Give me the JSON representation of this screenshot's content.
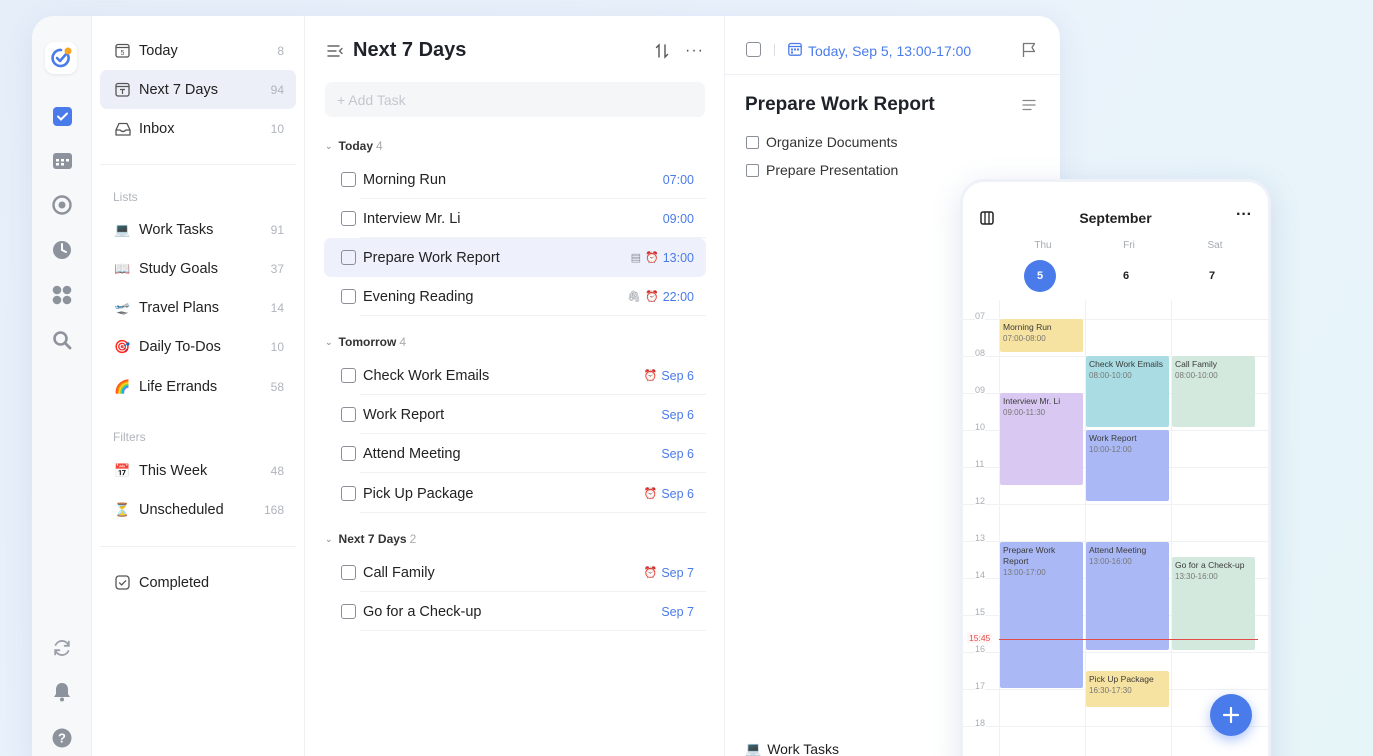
{
  "sidebar": {
    "smart": [
      {
        "label": "Today",
        "count": "8",
        "icon": "calendar-day-icon"
      },
      {
        "label": "Next 7 Days",
        "count": "94",
        "icon": "calendar-week-icon"
      },
      {
        "label": "Inbox",
        "count": "10",
        "icon": "inbox-icon"
      }
    ],
    "lists_label": "Lists",
    "lists": [
      {
        "emoji": "💻",
        "label": "Work Tasks",
        "count": "91"
      },
      {
        "emoji": "📖",
        "label": "Study Goals",
        "count": "37"
      },
      {
        "emoji": "🛫",
        "label": "Travel Plans",
        "count": "14"
      },
      {
        "emoji": "🎯",
        "label": "Daily To-Dos",
        "count": "10"
      },
      {
        "emoji": "🌈",
        "label": "Life Errands",
        "count": "58"
      }
    ],
    "filters_label": "Filters",
    "filters": [
      {
        "emoji": "📅",
        "label": "This Week",
        "count": "48"
      },
      {
        "emoji": "⏳",
        "label": "Unscheduled",
        "count": "168"
      }
    ],
    "completed_label": "Completed"
  },
  "tasklist": {
    "title": "Next 7 Days",
    "add_placeholder": "+ Add Task",
    "groups": [
      {
        "name": "Today",
        "count": "4",
        "tasks": [
          {
            "title": "Morning Run",
            "meta": "07:00"
          },
          {
            "title": "Interview Mr. Li",
            "meta": "09:00"
          },
          {
            "title": "Prepare Work Report",
            "meta": "13:00"
          },
          {
            "title": "Evening Reading",
            "meta": "22:00"
          }
        ]
      },
      {
        "name": "Tomorrow",
        "count": "4",
        "tasks": [
          {
            "title": "Check Work Emails",
            "meta": "Sep 6"
          },
          {
            "title": "Work Report",
            "meta": "Sep 6"
          },
          {
            "title": "Attend Meeting",
            "meta": "Sep 6"
          },
          {
            "title": "Pick Up Package",
            "meta": "Sep 6"
          }
        ]
      },
      {
        "name": "Next 7 Days",
        "count": "2",
        "tasks": [
          {
            "title": "Call Family",
            "meta": "Sep 7"
          },
          {
            "title": "Go for a Check-up",
            "meta": "Sep 7"
          }
        ]
      }
    ]
  },
  "detail": {
    "date": "Today, Sep 5, 13:00-17:00",
    "title": "Prepare Work Report",
    "subtasks": [
      "Organize Documents",
      "Prepare Presentation"
    ],
    "list_name": "Work Tasks"
  },
  "calendar": {
    "month": "September",
    "days": [
      {
        "dow": "Thu",
        "num": "5"
      },
      {
        "dow": "Fri",
        "num": "6"
      },
      {
        "dow": "Sat",
        "num": "7"
      }
    ],
    "hours": [
      "07",
      "08",
      "09",
      "10",
      "11",
      "12",
      "13",
      "14",
      "15",
      "16",
      "17",
      "18"
    ],
    "now": "15:45",
    "events": [
      {
        "title": "Morning Run",
        "time": "07:00-08:00"
      },
      {
        "title": "Interview Mr. Li",
        "time": "09:00-11:30"
      },
      {
        "title": "Prepare Work Report",
        "time": "13:00-17:00"
      },
      {
        "title": "Check Work Emails",
        "time": "08:00-10:00"
      },
      {
        "title": "Work Report",
        "time": "10:00-12:00"
      },
      {
        "title": "Attend Meeting",
        "time": "13:00-16:00"
      },
      {
        "title": "Pick Up Package",
        "time": "16:30-17:30"
      },
      {
        "title": "Call Family",
        "time": "08:00-10:00"
      },
      {
        "title": "Go for a Check-up",
        "time": "13:30-16:00"
      }
    ],
    "colors": {
      "yellow": "#f7e3a1",
      "purple": "#d9c9f2",
      "blue": "#aab9f5",
      "teal": "#a9dde3",
      "green": "#d4e9dd"
    }
  },
  "accent": "#4a7bea"
}
